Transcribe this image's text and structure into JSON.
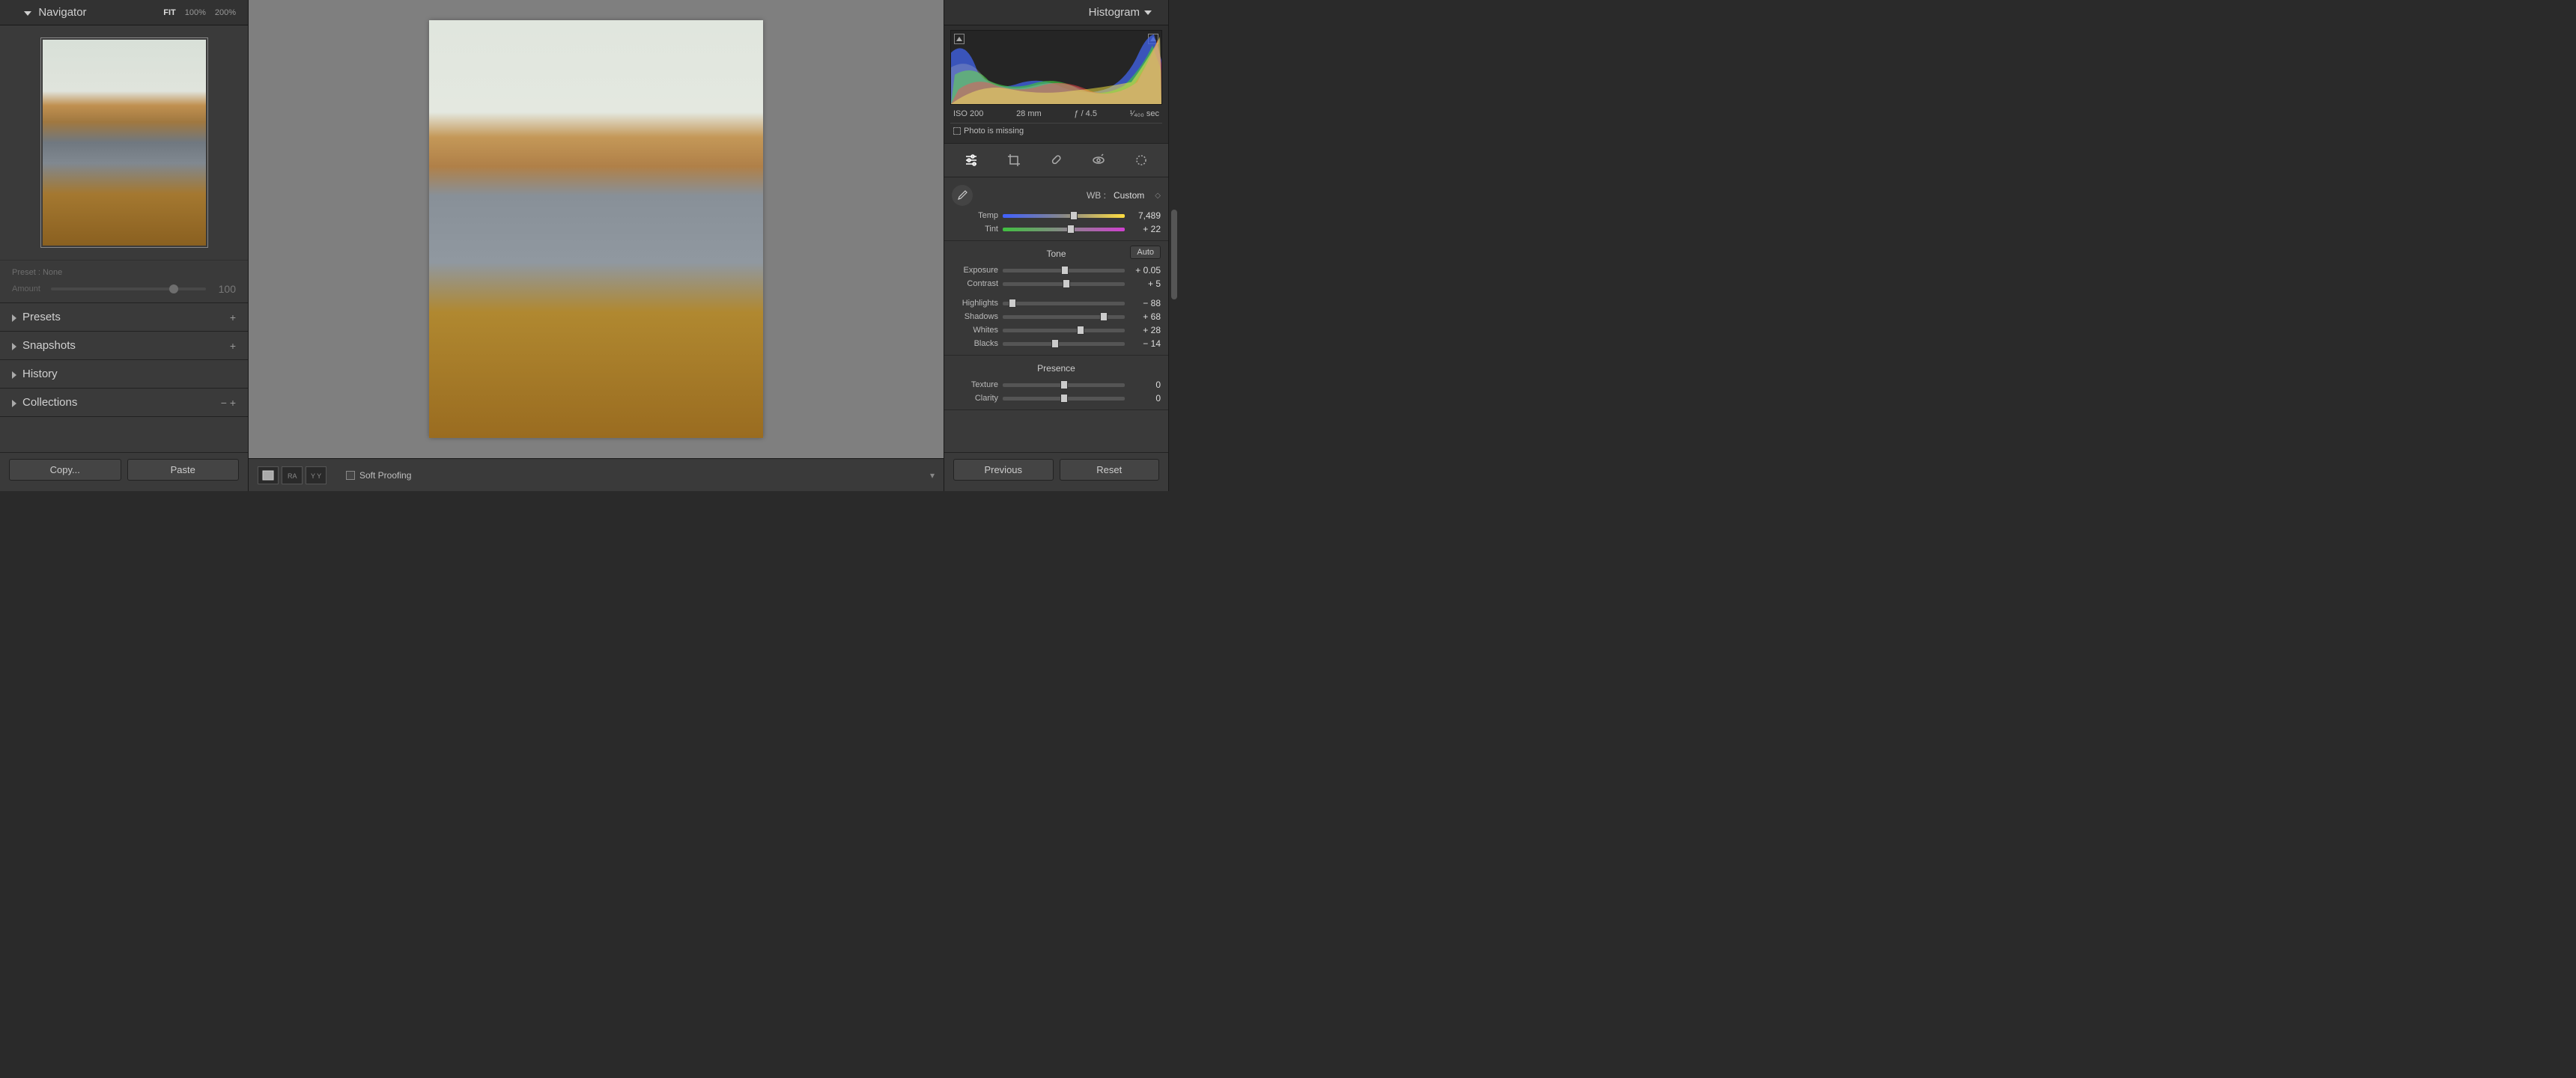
{
  "left": {
    "navigator_title": "Navigator",
    "zoom": {
      "fit": "FIT",
      "z100": "100%",
      "z200": "200%"
    },
    "preset_label": "Preset : None",
    "amount_label": "Amount",
    "amount_value": "100",
    "accordions": [
      {
        "title": "Presets",
        "icons": "+"
      },
      {
        "title": "Snapshots",
        "icons": "+"
      },
      {
        "title": "History",
        "icons": ""
      },
      {
        "title": "Collections",
        "icons": "−   +"
      }
    ],
    "copy_btn": "Copy...",
    "paste_btn": "Paste"
  },
  "center": {
    "soft_proofing": "Soft Proofing"
  },
  "right": {
    "histogram_title": "Histogram",
    "meta": {
      "iso": "ISO 200",
      "focal": "28 mm",
      "aperture": "ƒ / 4.5",
      "shutter": "¹⁄₄₀₀ sec"
    },
    "missing": "Photo is missing",
    "wb": {
      "label": "WB :",
      "mode": "Custom"
    },
    "sliders": {
      "temp": {
        "label": "Temp",
        "value": "7,489",
        "pos": 58
      },
      "tint": {
        "label": "Tint",
        "value": "+ 22",
        "pos": 56
      },
      "exposure": {
        "label": "Exposure",
        "value": "+ 0.05",
        "pos": 51
      },
      "contrast": {
        "label": "Contrast",
        "value": "+ 5",
        "pos": 52
      },
      "highlights": {
        "label": "Highlights",
        "value": "− 88",
        "pos": 8
      },
      "shadows": {
        "label": "Shadows",
        "value": "+ 68",
        "pos": 83
      },
      "whites": {
        "label": "Whites",
        "value": "+ 28",
        "pos": 64
      },
      "blacks": {
        "label": "Blacks",
        "value": "− 14",
        "pos": 43
      },
      "texture": {
        "label": "Texture",
        "value": "0",
        "pos": 50
      },
      "clarity": {
        "label": "Clarity",
        "value": "0",
        "pos": 50
      }
    },
    "tone_title": "Tone",
    "presence_title": "Presence",
    "auto_btn": "Auto",
    "previous_btn": "Previous",
    "reset_btn": "Reset"
  }
}
